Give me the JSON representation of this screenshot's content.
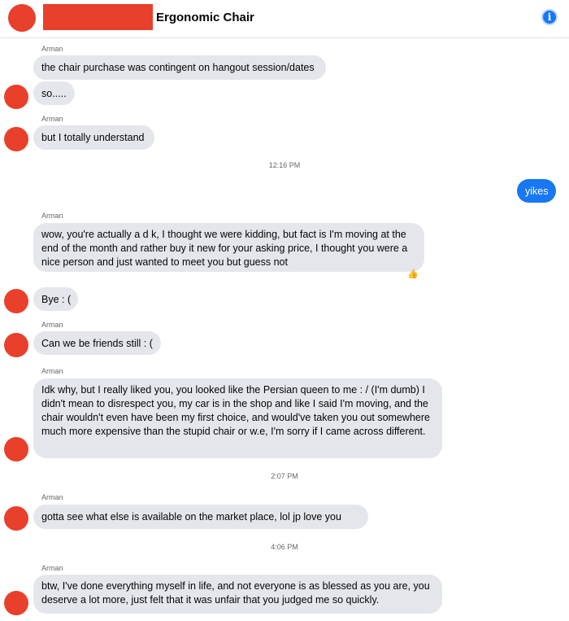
{
  "header": {
    "title": "Ergonomic Chair",
    "info_icon": "info-icon",
    "info_glyph": "i"
  },
  "sender_name": "Arman",
  "messages": [
    {
      "text": "the chair purchase was contingent on hangout session/dates"
    },
    {
      "text": "so....."
    },
    {
      "text": "but I totally understand"
    },
    {
      "text": "yikes"
    },
    {
      "text": "wow, you're actually a d k, I thought we were kidding, but fact is I'm moving at the end of the month and rather buy it new for your asking price, I thought you were a nice person and just wanted to meet you but guess not"
    },
    {
      "text": "Bye : ("
    },
    {
      "text": "Can we be friends still : ("
    },
    {
      "text": "Idk why, but I really liked you, you looked like the Persian queen to me : / (I'm dumb) I didn't mean to disrespect you, my car is in the shop and like I said I'm moving, and the chair wouldn't even have been my first choice, and would've taken you out somewhere much more expensive than the stupid chair or w.e, I'm sorry if I came across different."
    },
    {
      "text": "gotta see what else is available  on the market place, lol jp love you"
    },
    {
      "text": "btw, I've done everything myself in life, and not everyone is as blessed as you are, you deserve a lot more, just felt that it was unfair that you judged me so quickly."
    }
  ],
  "timestamps": [
    "12:16 PM",
    "2:07 PM",
    "4:06 PM"
  ],
  "reaction": {
    "icon": "thumbs-up-icon",
    "glyph": "👍"
  },
  "colors": {
    "outgoing_bubble": "#1877f2",
    "incoming_bubble": "#e4e6eb",
    "redaction": "#e8402a"
  }
}
